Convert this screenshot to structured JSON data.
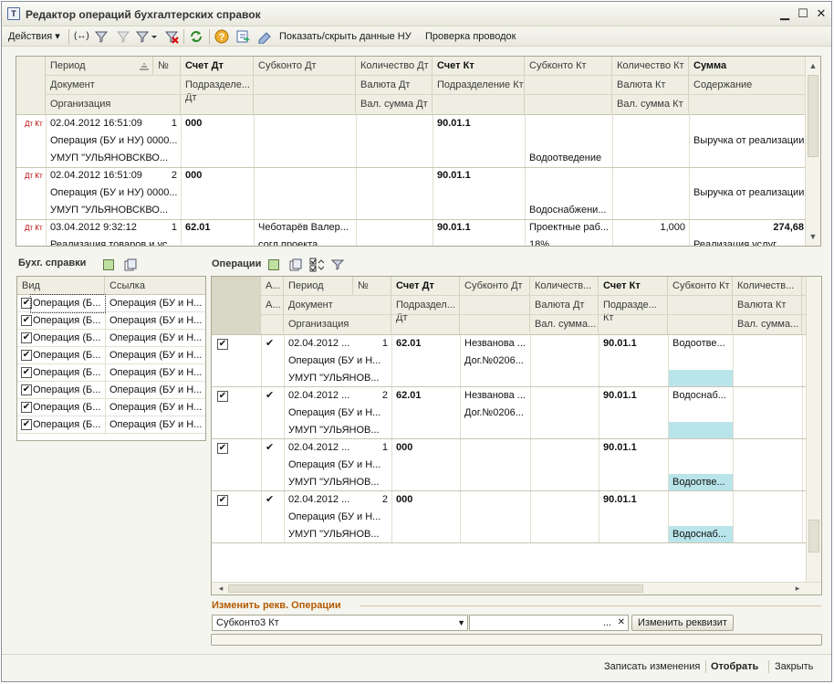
{
  "window": {
    "title": "Редактор операций бухгалтерских справок",
    "title_icon": "1c-form-icon",
    "controls": [
      "minimize-icon",
      "maximize-icon",
      "close-icon"
    ]
  },
  "toolbar": {
    "actions_label": "Действия",
    "show_hide_label": "Показать/скрыть данные НУ",
    "check_label": "Проверка проводок"
  },
  "top_grid": {
    "headers": {
      "period": "Период",
      "num": "№",
      "schet_dt": "Счет Дт",
      "subkonto_dt": "Субконто Дт",
      "kol_dt": "Количество Дт",
      "schet_kt": "Счет Кт",
      "subkonto_kt": "Субконто Кт",
      "kol_kt": "Количество Кт",
      "summa": "Сумма",
      "document": "Документ",
      "podr_dt": "Подразделе... Дт",
      "valuta_dt": "Валюта Дт",
      "podr_kt": "Подразделение Кт",
      "valuta_kt": "Валюта Кт",
      "soderzhanie": "Содержание",
      "org": "Организация",
      "val_summa_dt": "Вал. сумма Дт",
      "val_summa_kt": "Вал. сумма Кт"
    },
    "rows": [
      {
        "icon": "Дт Кт",
        "period": "02.04.2012 16:51:09",
        "num": "1",
        "schet_dt": "000",
        "schet_kt": "90.01.1",
        "document": "Операция (БУ и НУ) 0000...",
        "soderzhanie": "Выручка от реализации",
        "org": "УМУП \"УЛЬЯНОВСКВО...",
        "subkonto_kt": "Водоотведение"
      },
      {
        "icon": "Дт Кт",
        "period": "02.04.2012 16:51:09",
        "num": "2",
        "schet_dt": "000",
        "schet_kt": "90.01.1",
        "document": "Операция (БУ и НУ) 0000...",
        "soderzhanie": "Выручка от реализации",
        "org": "УМУП \"УЛЬЯНОВСКВО...",
        "subkonto_kt": "Водоснабжени..."
      },
      {
        "icon": "Дт Кт",
        "period": "03.04.2012 9:32:12",
        "num": "1",
        "schet_dt": "62.01",
        "subkonto_dt": "Чеботарёв  Валер...",
        "schet_kt": "90.01.1",
        "subkonto_kt": "Проектные раб...",
        "kol_kt": "1,000",
        "summa": "274,68",
        "document": "Реализация товаров и ус...",
        "doc2": "согл проекта",
        "kt2": "18%",
        "soderzhanie": "Реализация услуг"
      }
    ]
  },
  "left_panel": {
    "title": "Бухг. справки",
    "headers": {
      "vid": "Вид",
      "ssylka": "Ссылка"
    },
    "rows": [
      {
        "vid": "Операция (Б...",
        "ssylka": "Операция (БУ и Н..."
      },
      {
        "vid": "Операция (Б...",
        "ssylka": "Операция (БУ и Н..."
      },
      {
        "vid": "Операция (Б...",
        "ssylka": "Операция (БУ и Н..."
      },
      {
        "vid": "Операция (Б...",
        "ssylka": "Операция (БУ и Н..."
      },
      {
        "vid": "Операция (Б...",
        "ssylka": "Операция (БУ и Н..."
      },
      {
        "vid": "Операция (Б...",
        "ssylka": "Операция (БУ и Н..."
      },
      {
        "vid": "Операция (Б...",
        "ssylka": "Операция (БУ и Н..."
      },
      {
        "vid": "Операция (Б...",
        "ssylka": "Операция (БУ и Н..."
      }
    ]
  },
  "operations": {
    "title": "Операции",
    "headers": {
      "a1": "А...",
      "period": "Период",
      "num": "№",
      "schet_dt": "Счет Дт",
      "subkonto_dt": "Субконто Дт",
      "kol_dt": "Количеств...",
      "schet_kt": "Счет Кт",
      "subkonto_kt": "Субконто Кт",
      "kol_kt": "Количеств...",
      "a2": "А...",
      "document": "Документ",
      "podr_dt": "Подраздел... Дт",
      "valuta_dt": "Валюта Дт",
      "podr_kt": "Подразде... Кт",
      "valuta_kt": "Валюта Кт",
      "org": "Организация",
      "val_summa_dt": "Вал. сумма...",
      "val_summa_kt": "Вал. сумма..."
    },
    "rows": [
      {
        "period": "02.04.2012 ...",
        "num": "1",
        "schet_dt": "62.01",
        "subkonto_dt": "Незванова ...",
        "subkonto_dt2": "Дог.№0206...",
        "schet_kt": "90.01.1",
        "subkonto_kt": "Водоотве...",
        "document": "Операция (БУ и Н...",
        "org": "УМУП \"УЛЬЯНОВ..."
      },
      {
        "period": "02.04.2012 ...",
        "num": "2",
        "schet_dt": "62.01",
        "subkonto_dt": "Незванова ...",
        "subkonto_dt2": "Дог.№0206...",
        "schet_kt": "90.01.1",
        "subkonto_kt": "Водоснаб...",
        "document": "Операция (БУ и Н...",
        "org": "УМУП \"УЛЬЯНОВ..."
      },
      {
        "period": "02.04.2012 ...",
        "num": "1",
        "schet_dt": "000",
        "schet_kt": "90.01.1",
        "subkonto_kt3": "Водоотве...",
        "document": "Операция (БУ и Н...",
        "org": "УМУП \"УЛЬЯНОВ..."
      },
      {
        "period": "02.04.2012 ...",
        "num": "2",
        "schet_dt": "000",
        "schet_kt": "90.01.1",
        "subkonto_kt3": "Водоснаб...",
        "document": "Операция (БУ и Н...",
        "org": "УМУП \"УЛЬЯНОВ..."
      }
    ]
  },
  "change_section": {
    "title": "Изменить рекв. Операции",
    "select_value": "Субконто3 Кт",
    "value_field": "",
    "browse": "...",
    "clear": "✕",
    "apply_button": "Изменить реквизит"
  },
  "footer": {
    "save": "Записать изменения",
    "select": "Отобрать",
    "close": "Закрыть"
  },
  "colors": {
    "accent_orange": "#b35a00",
    "highlight_cyan": "#b9e5ea"
  }
}
